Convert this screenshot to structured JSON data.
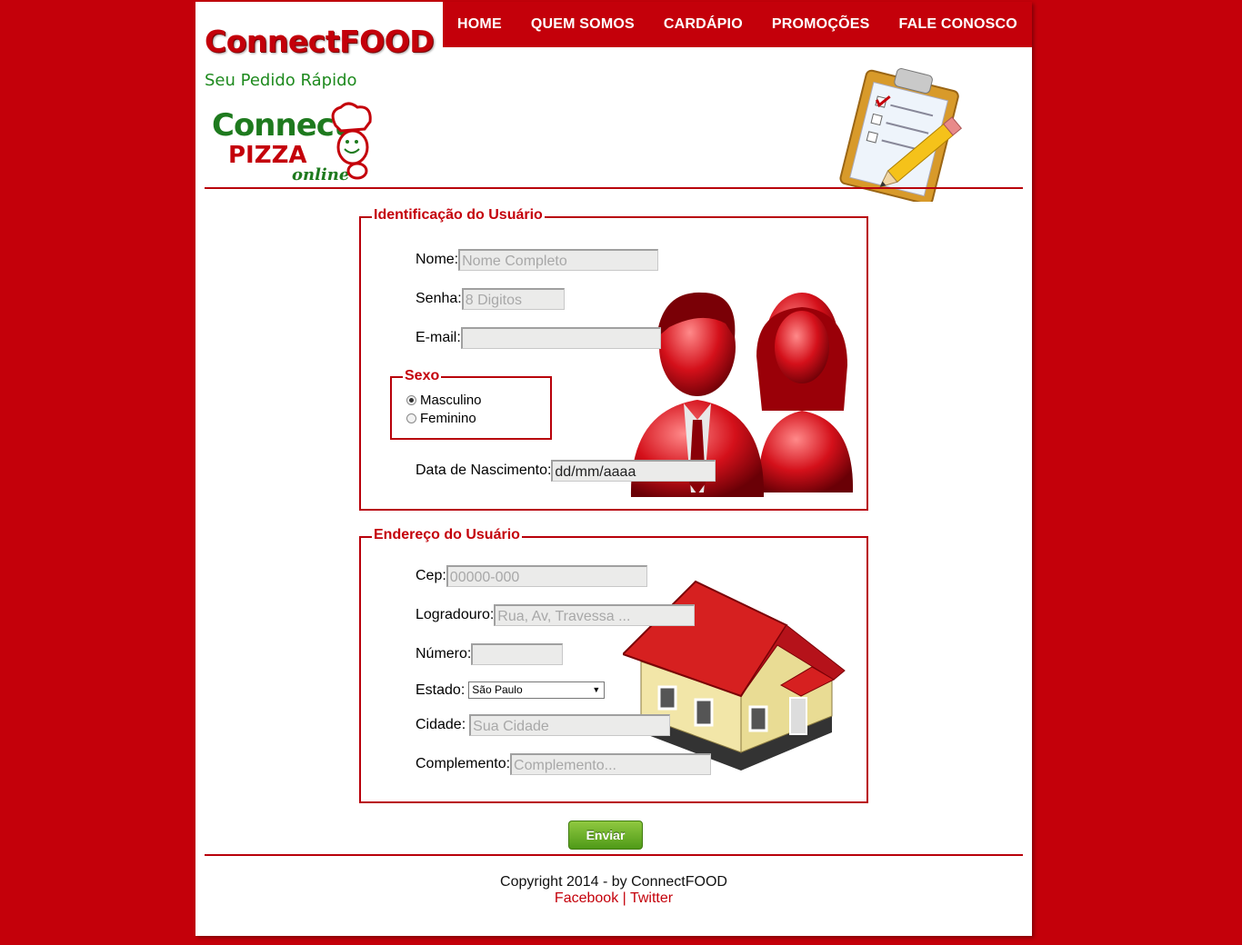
{
  "nav": {
    "items": [
      "HOME",
      "QUEM SOMOS",
      "CARDÁPIO",
      "PROMOÇÕES",
      "FALE CONOSCO"
    ]
  },
  "brand": {
    "title": "ConnectFOOD",
    "tagline": "Seu Pedido Rápido",
    "logo_line1": "Connect",
    "logo_line2": "PIZZA",
    "logo_line3": "online"
  },
  "identificacao": {
    "legend": "Identificação do Usuário",
    "nome_label": "Nome:",
    "nome_placeholder": "Nome Completo",
    "senha_label": "Senha:",
    "senha_placeholder": "8 Digitos",
    "email_label": "E-mail:",
    "email_placeholder": "",
    "sexo": {
      "legend": "Sexo",
      "options": [
        "Masculino",
        "Feminino"
      ],
      "selected": "Masculino"
    },
    "nascimento_label": "Data de Nascimento:",
    "nascimento_value": "dd/mm/aaaa"
  },
  "endereco": {
    "legend": "Endereço do Usuário",
    "cep_label": "Cep:",
    "cep_placeholder": "00000-000",
    "logradouro_label": "Logradouro:",
    "logradouro_placeholder": "Rua, Av, Travessa ...",
    "numero_label": "Número:",
    "numero_placeholder": "",
    "estado_label": "Estado:",
    "estado_selected": "São Paulo",
    "cidade_label": "Cidade:",
    "cidade_placeholder": "Sua Cidade",
    "complemento_label": "Complemento:",
    "complemento_placeholder": "Complemento..."
  },
  "submit_label": "Enviar",
  "footer": {
    "copyright": "Copyright 2014 - by ConnectFOOD",
    "facebook": "Facebook",
    "separator": "|",
    "twitter": "Twitter"
  },
  "colors": {
    "brand_red": "#c4000a",
    "brand_green": "#1e8a1e",
    "button_green": "#4f9a18"
  }
}
